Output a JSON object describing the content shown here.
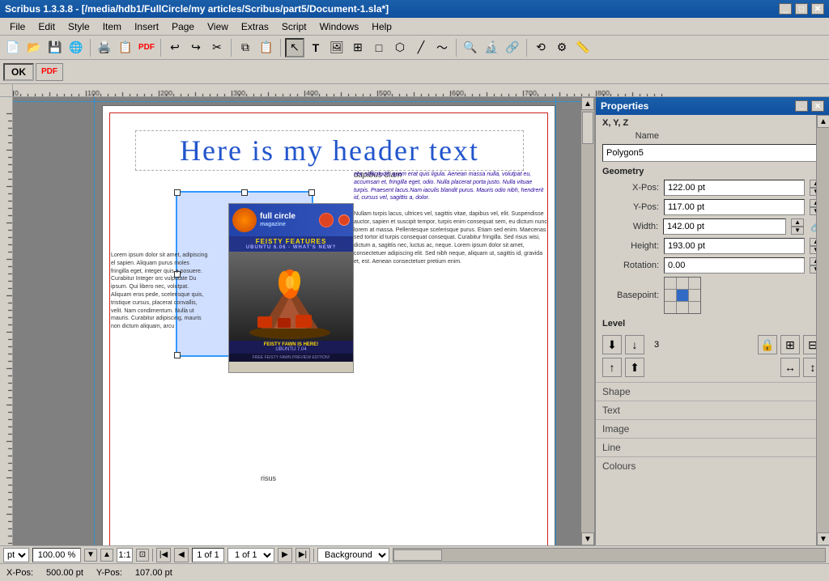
{
  "titlebar": {
    "title": "Scribus 1.3.3.8 - [/media/hdb1/FullCircle/my articles/Scribus/part5/Document-1.sla*]"
  },
  "menubar": {
    "items": [
      "File",
      "Edit",
      "Style",
      "Item",
      "Insert",
      "Page",
      "View",
      "Extras",
      "Script",
      "Windows",
      "Help"
    ]
  },
  "toolbar2": {
    "ok_label": "OK",
    "pdf_label": "PDF"
  },
  "properties": {
    "title": "Properties",
    "xyz_label": "X, Y, Z",
    "name_label": "Name",
    "name_value": "Polygon5",
    "geometry_label": "Geometry",
    "xpos_label": "X-Pos:",
    "xpos_value": "122.00 pt",
    "ypos_label": "Y-Pos:",
    "ypos_value": "117.00 pt",
    "width_label": "Width:",
    "width_value": "142.00 pt",
    "height_label": "Height:",
    "height_value": "193.00 pt",
    "rotation_label": "Rotation:",
    "rotation_value": "0.00",
    "basepoint_label": "Basepoint:",
    "level_label": "Level",
    "level_value": "3",
    "shape_label": "Shape",
    "text_label": "Text",
    "image_label": "Image",
    "line_label": "Line",
    "colours_label": "Colours"
  },
  "canvas": {
    "header_text": "Here  is  my  header  text",
    "dapibus_text": "dapibus diam",
    "lorem_text": "Lorem ipsum dolor sit amet, adipiscing el sapien. Aliquam purus moles fringilla eget, integer quis e posuere. Curabitur Integer orc vulputate Du ipsum. Qui libero nec, volutpat. Aliquam eros pede, scelerisque quis, tristique cursus, placerat convallis, velit. Nam condimentum. Nulla ut mauris. Curabitur adipiscing, mauris non dictum aliquam, arcu",
    "risus_text": "risus",
    "right_text_1": "nec sollicitudin quam erat quis ligula. Aenean massa nulla, volutpat eu, accumsan et, fringilla eget, odio. Nulla placerat porta justo. Nulla vituae turpis. Praesent lacus.Nam iaculis blandit purus. Mauris odio nibh, hendrerit id, cursus vel, sagittis a, dolor.",
    "right_text_2": "Nullam turpis lacus, ultrices vel, sagittis vitae, dapibus vel, elit. Suspendisse auctor, sapien et suscipit tempor, turpis enim consequat sem, eu dictum nunc lorem at massa. Pellentesque scelerisque purus. Etiam sed enim. Maecenas sed tortor id turpis consequat consequat. Curabitur fringilla. Sed risus wisi, dictum a, sagittis nec, luctus ac, neque. Lorem ipsum dolor sit amet, consectetuer adipiscing elit. Sed nibh neque, aliquam ut, sagittis id, gravida et, est. Aenean consectetuer pretium enim.",
    "fc_title": "full circle",
    "fc_subtitle": "FEISTY FEATURES",
    "fc_ubuntu": "UBUNTU 6.06 - WHAT'S NEW?",
    "fc_feisty": "FEISTY FAWN IS HERE!",
    "fc_ubuntu2": "UBUNTU 7.04",
    "fc_footer": "FREE FEISTY FAWN PREVIEW EDITION!"
  },
  "navbar": {
    "unit_label": "pt",
    "zoom_label": "100.00 %",
    "ratio_label": "1:1",
    "page_label": "1 of 1",
    "background_label": "Background"
  },
  "statusbar": {
    "xpos_label": "X-Pos:",
    "xpos_value": "500.00 pt",
    "ypos_label": "Y-Pos:",
    "ypos_value": "107.00 pt"
  }
}
